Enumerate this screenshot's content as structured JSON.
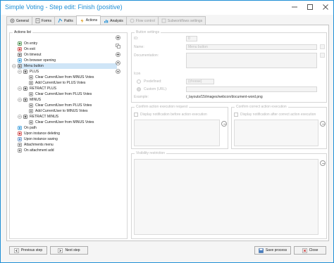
{
  "window": {
    "title": "Simple Voting - Step edit: Finish (positive)"
  },
  "tabs": [
    {
      "label": "General",
      "icon": "gear-icon",
      "state": "normal"
    },
    {
      "label": "Forms",
      "icon": "form-icon",
      "state": "normal"
    },
    {
      "label": "Paths",
      "icon": "paths-icon",
      "state": "normal"
    },
    {
      "label": "Actions",
      "icon": "actions-icon",
      "state": "active"
    },
    {
      "label": "Analysis",
      "icon": "analysis-icon",
      "state": "normal"
    },
    {
      "label": "Flow control",
      "icon": "flow-control-icon",
      "state": "disabled"
    },
    {
      "label": "Subworkflows settings",
      "icon": "subworkflow-icon",
      "state": "disabled"
    }
  ],
  "actions_list": {
    "label": "Actions list",
    "items": [
      {
        "label": "On entry",
        "icon": "entry-icon"
      },
      {
        "label": "On exit",
        "icon": "exit-icon"
      },
      {
        "label": "On timeout",
        "icon": "clock-icon"
      },
      {
        "label": "On browser opening",
        "icon": "browser-icon"
      },
      {
        "label": "Menu button",
        "icon": "menu-button-icon",
        "selected": true
      },
      {
        "label": "PLUS",
        "icon": "menu-button-icon"
      },
      {
        "label": "Clear CurrentUser from MINUS Votes",
        "icon": "action-icon"
      },
      {
        "label": "Add CurrentUser to PLUS Votes",
        "icon": "action-icon"
      },
      {
        "label": "RETRACT PLUS",
        "icon": "menu-button-icon"
      },
      {
        "label": "Clear CurrentUser from PLUS Votes",
        "icon": "action-icon"
      },
      {
        "label": "MINUS",
        "icon": "menu-button-icon"
      },
      {
        "label": "Clear CurrentUser from PLUS Votes",
        "icon": "action-icon"
      },
      {
        "label": "Add CurrentUser to MINUS Votes",
        "icon": "action-icon"
      },
      {
        "label": "RETRACT MINUS",
        "icon": "menu-button-icon"
      },
      {
        "label": "Clear CurrentUser from MINUS Votes",
        "icon": "action-icon"
      },
      {
        "label": "On path",
        "icon": "path-icon"
      },
      {
        "label": "Upon instance deleting",
        "icon": "delete-icon"
      },
      {
        "label": "Upon instance saving",
        "icon": "save-icon"
      },
      {
        "label": "Attachments menu",
        "icon": "attachment-icon"
      },
      {
        "label": "On attachment add",
        "icon": "attachment-add-icon"
      }
    ]
  },
  "button_settings": {
    "label": "Button settings",
    "id_label": "ID:",
    "id_value": "0",
    "name_label": "Name:",
    "name_value": "Menu button",
    "documentation_label": "Documentation:",
    "icon_label": "Icon",
    "predefined_label": "Predefined:",
    "predefined_value": "(choose)",
    "custom_label": "Custom (URL):",
    "custom_value": "/_layouts/15/images/webcon/document-word.png",
    "example_label": "Example:"
  },
  "confirm_before": {
    "label": "Confirm action execution request",
    "checkbox_label": "Display notification before action execution"
  },
  "confirm_after": {
    "label": "Confirm correct action execution",
    "checkbox_label": "Display notification after correct action execution"
  },
  "visibility": {
    "label": "Visibility restriction"
  },
  "footer": {
    "previous_label": "Previous step",
    "next_label": "Next step",
    "save_label": "Save process",
    "close_label": "Close"
  },
  "colors": {
    "accent": "#1f8fd6",
    "selection": "#cfe5f7"
  }
}
